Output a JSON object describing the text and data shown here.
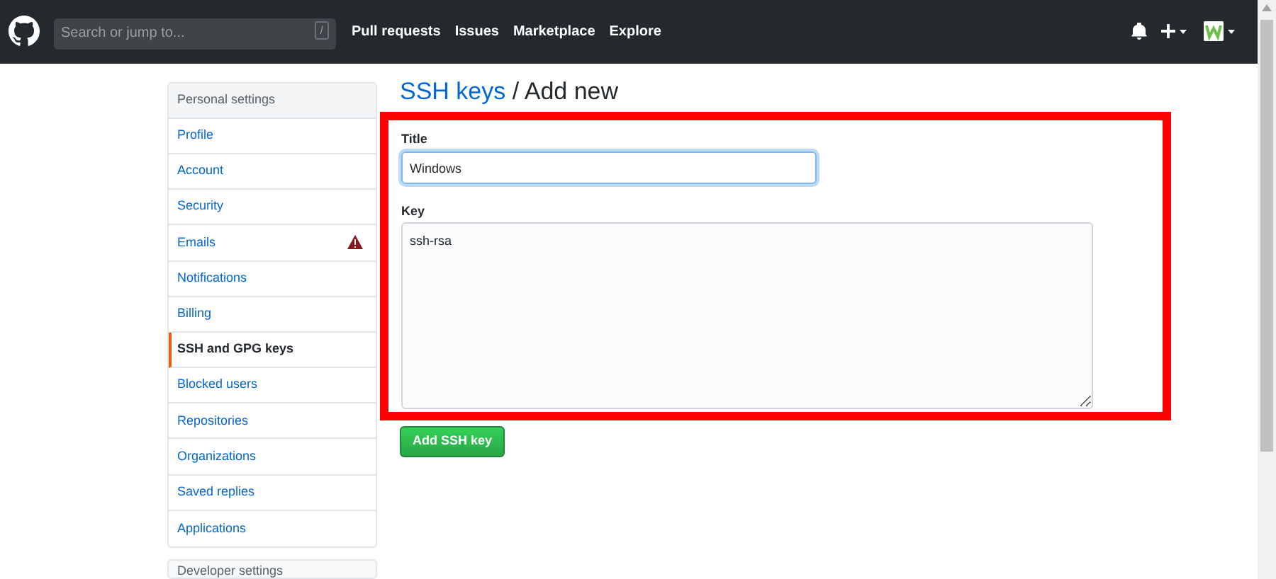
{
  "header": {
    "search": {
      "placeholder": "Search or jump to...",
      "shortcut": "/"
    },
    "nav": [
      "Pull requests",
      "Issues",
      "Marketplace",
      "Explore"
    ]
  },
  "sidebar": {
    "heading": "Personal settings",
    "items": [
      {
        "label": "Profile",
        "selected": false,
        "warning": false
      },
      {
        "label": "Account",
        "selected": false,
        "warning": false
      },
      {
        "label": "Security",
        "selected": false,
        "warning": false
      },
      {
        "label": "Emails",
        "selected": false,
        "warning": true
      },
      {
        "label": "Notifications",
        "selected": false,
        "warning": false
      },
      {
        "label": "Billing",
        "selected": false,
        "warning": false
      },
      {
        "label": "SSH and GPG keys",
        "selected": true,
        "warning": false
      },
      {
        "label": "Blocked users",
        "selected": false,
        "warning": false
      },
      {
        "label": "Repositories",
        "selected": false,
        "warning": false
      },
      {
        "label": "Organizations",
        "selected": false,
        "warning": false
      },
      {
        "label": "Saved replies",
        "selected": false,
        "warning": false
      },
      {
        "label": "Applications",
        "selected": false,
        "warning": false
      }
    ],
    "second_heading": "Developer settings"
  },
  "main": {
    "breadcrumb_link": "SSH keys",
    "breadcrumb_current": "/ Add new",
    "title_label": "Title",
    "title_value": "Windows",
    "key_label": "Key",
    "key_value": "ssh-rsa",
    "button": "Add SSH key"
  }
}
